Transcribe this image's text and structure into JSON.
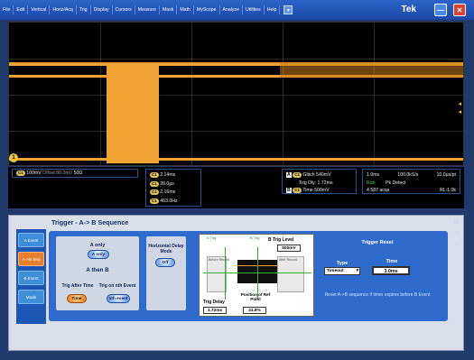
{
  "menu": [
    "File",
    "Edit",
    "Vertical",
    "Horiz/Acq",
    "Trig",
    "Display",
    "Cursors",
    "Measure",
    "Mask",
    "Math",
    "MyScope",
    "Analyze",
    "Utilities",
    "Help"
  ],
  "brand": "Tek",
  "window": {
    "min": "—",
    "close": "✕"
  },
  "scope": {
    "ch_marker": "1"
  },
  "channel": {
    "chip": "C1",
    "scale": "100mV",
    "offset": "Offset:80.0mV",
    "imp": "50Ω"
  },
  "measurements": [
    {
      "chip": "C1",
      "value": "2.14ms"
    },
    {
      "chip": "C1",
      "value": "20.0μs"
    },
    {
      "chip": "C1",
      "value": "2.16ms"
    },
    {
      "chip": "C1",
      "value": "463.0Hz"
    }
  ],
  "trigger_info": {
    "a_label": "A",
    "a_chip": "C1",
    "a_type": "Glitch",
    "a_level": "540mV",
    "delay": "Trig Dly: 1.72ms",
    "b_label": "B",
    "b_chip": "C1",
    "b_type": "Time",
    "b_value": "500mV"
  },
  "acq_info": {
    "time_div": "1.0ms",
    "sample_rate": "100.0kS/s",
    "res": "10.0μs/pt",
    "run": "Run",
    "mode": "Pk Detect",
    "acqs": "4 587 acqs",
    "rl": "RL:1.0k"
  },
  "panel": {
    "title": "Trigger - A-> B Sequence",
    "tabs": [
      "A Event",
      "A->B Seq",
      "B Event",
      "Mode"
    ],
    "a_only_label": "A only",
    "a_only_btn": "A only",
    "a_then_b": "A then B",
    "trig_after_time": "Trig After Time",
    "trig_nth": "Trig on nth Event",
    "time_btn": "Time",
    "nth_btn": "nth event",
    "horiz_delay": "Horizontal Delay Mode",
    "off_btn": "Off",
    "b_trig_level": "B Trig Level",
    "b_trig_value": "500mV",
    "before_record": "Before Record",
    "after_record": "After Record",
    "a_trig": "A Trig",
    "b_trig": "B Trig",
    "trig_delay_label": "Trig Delay",
    "trig_delay_value": "1.72ms",
    "pos_label": "Position of Ref Point",
    "pos_value": "41.8%",
    "trigger_reset": "Trigger Reset",
    "type_label": "Type",
    "type_value": "Timeout",
    "time_label": "Time",
    "time_value": "3.0ms",
    "reset_note": "Reset A->B sequence if timer expires before B Event"
  }
}
